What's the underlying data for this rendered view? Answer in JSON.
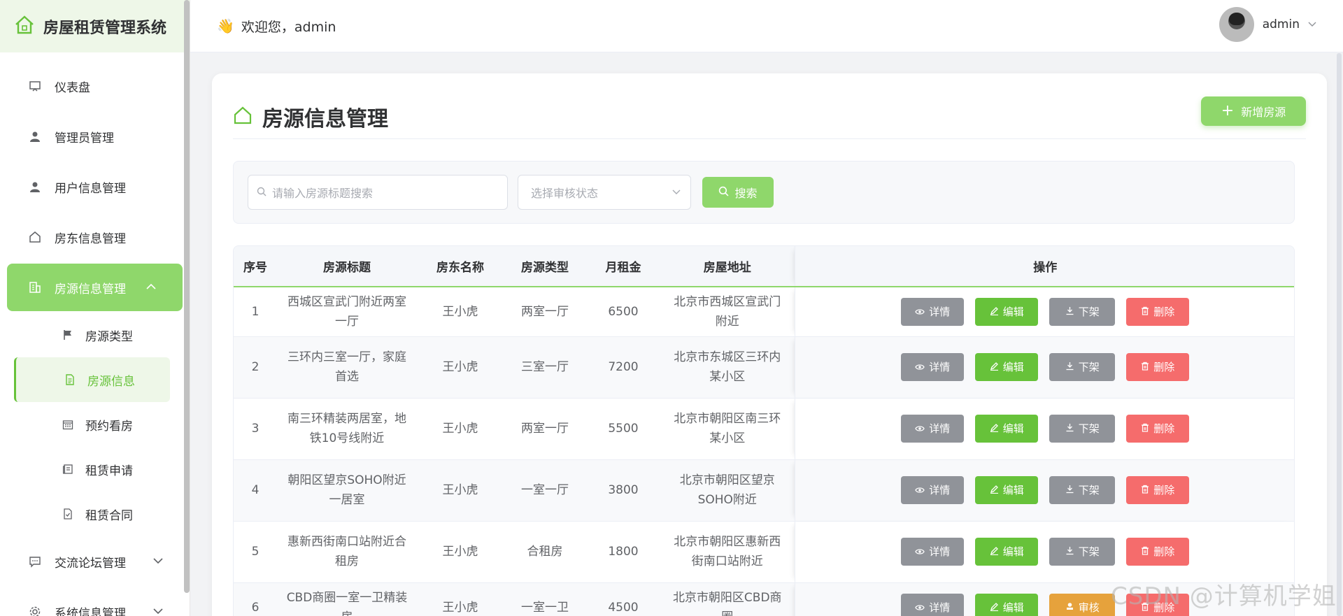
{
  "app": {
    "title": "房屋租赁管理系统"
  },
  "header": {
    "welcome": "欢迎您，admin",
    "username": "admin"
  },
  "sidebar": {
    "items": [
      {
        "label": "仪表盘"
      },
      {
        "label": "管理员管理"
      },
      {
        "label": "用户信息管理"
      },
      {
        "label": "房东信息管理"
      },
      {
        "label": "房源信息管理"
      },
      {
        "label": "交流论坛管理"
      },
      {
        "label": "系统信息管理"
      }
    ],
    "subitems": [
      {
        "label": "房源类型"
      },
      {
        "label": "房源信息"
      },
      {
        "label": "预约看房"
      },
      {
        "label": "租赁申请"
      },
      {
        "label": "租赁合同"
      }
    ]
  },
  "page": {
    "title": "房源信息管理",
    "add_label": "新增房源"
  },
  "search": {
    "placeholder": "请输入房源标题搜索",
    "status_placeholder": "选择审核状态",
    "button": "搜索"
  },
  "table": {
    "headers": [
      "序号",
      "房源标题",
      "房东名称",
      "房源类型",
      "月租金",
      "房屋地址",
      "操作"
    ],
    "rows": [
      {
        "no": "1",
        "title": "西城区宣武门附近两室一厅",
        "landlord": "王小虎",
        "type": "两室一厅",
        "rent": "6500",
        "address": "北京市西城区宣武门附近",
        "action": "下架"
      },
      {
        "no": "2",
        "title": "三环内三室一厅，家庭首选",
        "landlord": "王小虎",
        "type": "三室一厅",
        "rent": "7200",
        "address": "北京市东城区三环内某小区",
        "action": "下架"
      },
      {
        "no": "3",
        "title": "南三环精装两居室，地铁10号线附近",
        "landlord": "王小虎",
        "type": "两室一厅",
        "rent": "5500",
        "address": "北京市朝阳区南三环某小区",
        "action": "下架"
      },
      {
        "no": "4",
        "title": "朝阳区望京SOHO附近一居室",
        "landlord": "王小虎",
        "type": "一室一厅",
        "rent": "3800",
        "address": "北京市朝阳区望京SOHO附近",
        "action": "下架"
      },
      {
        "no": "5",
        "title": "惠新西街南口站附近合租房",
        "landlord": "王小虎",
        "type": "合租房",
        "rent": "1800",
        "address": "北京市朝阳区惠新西街南口站附近",
        "action": "下架"
      },
      {
        "no": "6",
        "title": "CBD商圈一室一卫精装房",
        "landlord": "王小虎",
        "type": "一室一卫",
        "rent": "4500",
        "address": "北京市朝阳区CBD商圈",
        "action": "审核"
      }
    ],
    "btn_detail": "详情",
    "btn_edit": "编辑",
    "btn_delete": "删除"
  },
  "watermark": "CSDN @计算机学姐",
  "colors": {
    "accent": "#8fd76b",
    "success": "#67c23a",
    "info": "#909399",
    "warning": "#e6a23c",
    "danger": "#f56c6c"
  }
}
